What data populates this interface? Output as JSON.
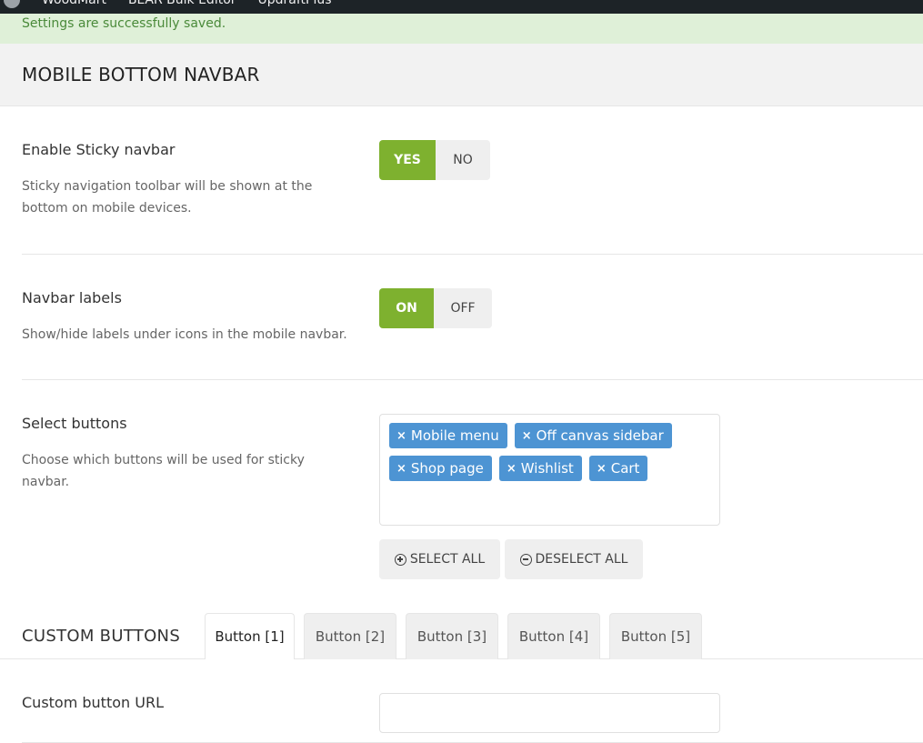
{
  "adminbar": {
    "items": [
      "WoodMart",
      "BEAR Bulk Editor",
      "UpdraftPlus"
    ]
  },
  "notice": {
    "text": "Settings are successfully saved."
  },
  "section": {
    "title": "MOBILE BOTTOM NAVBAR"
  },
  "fields": {
    "sticky": {
      "title": "Enable Sticky navbar",
      "desc": "Sticky navigation toolbar will be shown at the bottom on mobile devices.",
      "yes_label": "YES",
      "no_label": "NO",
      "value": "YES"
    },
    "labels": {
      "title": "Navbar labels",
      "desc": "Show/hide labels under icons in the mobile navbar.",
      "on_label": "ON",
      "off_label": "OFF",
      "value": "ON"
    },
    "select_buttons": {
      "title": "Select buttons",
      "desc": "Choose which buttons will be used for sticky navbar.",
      "tags": [
        "Mobile menu",
        "Off canvas sidebar",
        "Shop page",
        "Wishlist",
        "Cart"
      ],
      "remove_glyph": "×",
      "select_all_label": "SELECT ALL",
      "deselect_all_label": "DESELECT ALL"
    }
  },
  "custom_buttons": {
    "title": "CUSTOM BUTTONS",
    "tabs": [
      "Button [1]",
      "Button [2]",
      "Button [3]",
      "Button [4]",
      "Button [5]"
    ],
    "active_tab": "Button [1]",
    "url_field": {
      "label": "Custom button URL",
      "value": "",
      "placeholder": ""
    }
  },
  "colors": {
    "accent_green": "#7eb12f",
    "tag_blue": "#4d94d3",
    "notice_bg": "#dff0d8",
    "notice_text": "#4a8a3a"
  }
}
